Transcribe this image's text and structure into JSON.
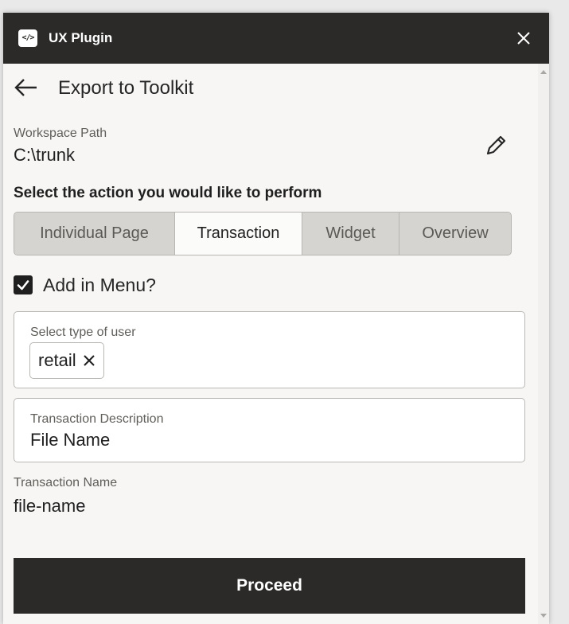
{
  "window": {
    "app_title": "UX Plugin",
    "app_icon_text": "</>",
    "colors": {
      "titlebar": "#2b2a28",
      "background": "#f7f6f4",
      "active_tab": "#fbfbfa",
      "inactive_tab": "#d5d4d0"
    }
  },
  "header": {
    "back_icon": "arrow-left-icon",
    "title": "Export to Toolkit"
  },
  "workspace": {
    "label": "Workspace Path",
    "value": "C:\\trunk",
    "edit_icon": "pencil-icon"
  },
  "action": {
    "prompt": "Select the action you would like to perform",
    "tabs": [
      {
        "label": "Individual Page",
        "active": false
      },
      {
        "label": "Transaction",
        "active": true
      },
      {
        "label": "Widget",
        "active": false
      },
      {
        "label": "Overview",
        "active": false
      }
    ]
  },
  "menu_option": {
    "label": "Add in Menu?",
    "checked": true
  },
  "user_type": {
    "label": "Select type of user",
    "chips": [
      {
        "text": "retail"
      }
    ]
  },
  "transaction_description": {
    "label": "Transaction Description",
    "value": "File Name"
  },
  "transaction_name": {
    "label": "Transaction Name",
    "value": "file-name"
  },
  "footer": {
    "proceed_label": "Proceed"
  }
}
